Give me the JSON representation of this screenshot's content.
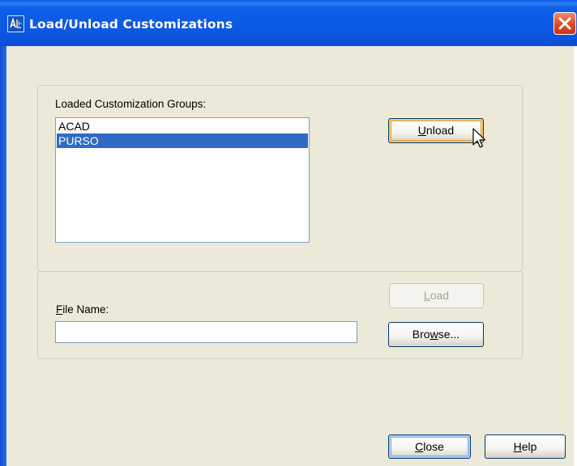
{
  "window": {
    "title": "Load/Unload Customizations",
    "app_icon": "autocad-app-icon",
    "close_icon": "close-x-icon"
  },
  "loaded_groups": {
    "label": "Loaded Customization Groups:",
    "items": [
      {
        "label": "ACAD",
        "selected": false
      },
      {
        "label": "PURSO",
        "selected": true
      }
    ]
  },
  "buttons": {
    "unload": {
      "prefix": "",
      "mnemonic": "U",
      "rest": "nload"
    },
    "load": {
      "prefix": "",
      "mnemonic": "L",
      "rest": "oad",
      "enabled": false
    },
    "browse": {
      "prefix": "Bro",
      "mnemonic": "w",
      "rest": "se..."
    },
    "close": {
      "prefix": "",
      "mnemonic": "C",
      "rest": "lose"
    },
    "help": {
      "prefix": "",
      "mnemonic": "H",
      "rest": "elp"
    }
  },
  "file_name": {
    "mnemonic": "F",
    "rest": "ile Name:",
    "value": ""
  },
  "colors": {
    "titlebar": "#0b57e1",
    "dialog_bg": "#ece9d8",
    "selection": "#316ac5",
    "close_button": "#de4a22"
  }
}
